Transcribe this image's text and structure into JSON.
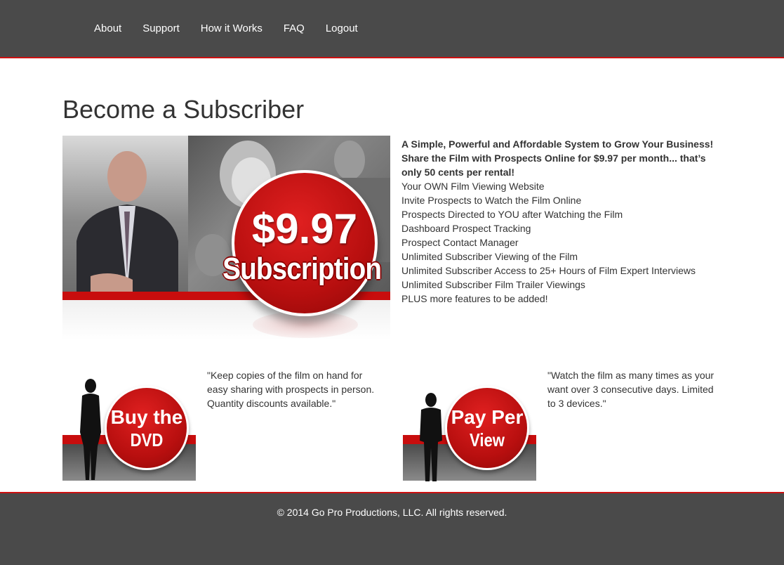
{
  "nav": {
    "items": [
      "About",
      "Support",
      "How it Works",
      "FAQ",
      "Logout"
    ]
  },
  "page": {
    "title": "Become a Subscriber"
  },
  "hero": {
    "price": "$9.97",
    "label": "Subscription"
  },
  "features": {
    "headline_lines": [
      "A Simple, Powerful and Affordable System to Grow Your Business!",
      "Share the Film with Prospects Online for $9.97 per month... that’s",
      "only 50 cents per rental!"
    ],
    "items": [
      "Your OWN Film Viewing Website",
      "Invite Prospects to Watch the Film Online",
      "Prospects Directed to YOU after Watching the Film",
      "Dashboard Prospect Tracking",
      "Prospect Contact Manager",
      "Unlimited Subscriber Viewing of the Film",
      "Unlimited Subscriber Access to 25+ Hours of Film Expert Interviews",
      "Unlimited Subscriber Film Trailer Viewings",
      "PLUS more features to be added!"
    ]
  },
  "promos": {
    "dvd": {
      "line1": "Buy the",
      "line2": "DVD",
      "quote_lines": [
        "\"Keep copies of the film on hand for",
        "easy sharing with prospects in person.",
        "Quantity discounts available.\""
      ]
    },
    "ppv": {
      "line1": "Pay Per",
      "line2": "View",
      "quote_lines": [
        "\"Watch the film as many times as your",
        "want over 3 consecutive days. Limited",
        "to 3 devices.\""
      ]
    }
  },
  "footer": {
    "copyright": "© 2014 Go Pro Productions, LLC. All rights reserved."
  },
  "colors": {
    "header_bg": "#4a4a4a",
    "accent_red": "#c80d0d",
    "text": "#333333"
  }
}
